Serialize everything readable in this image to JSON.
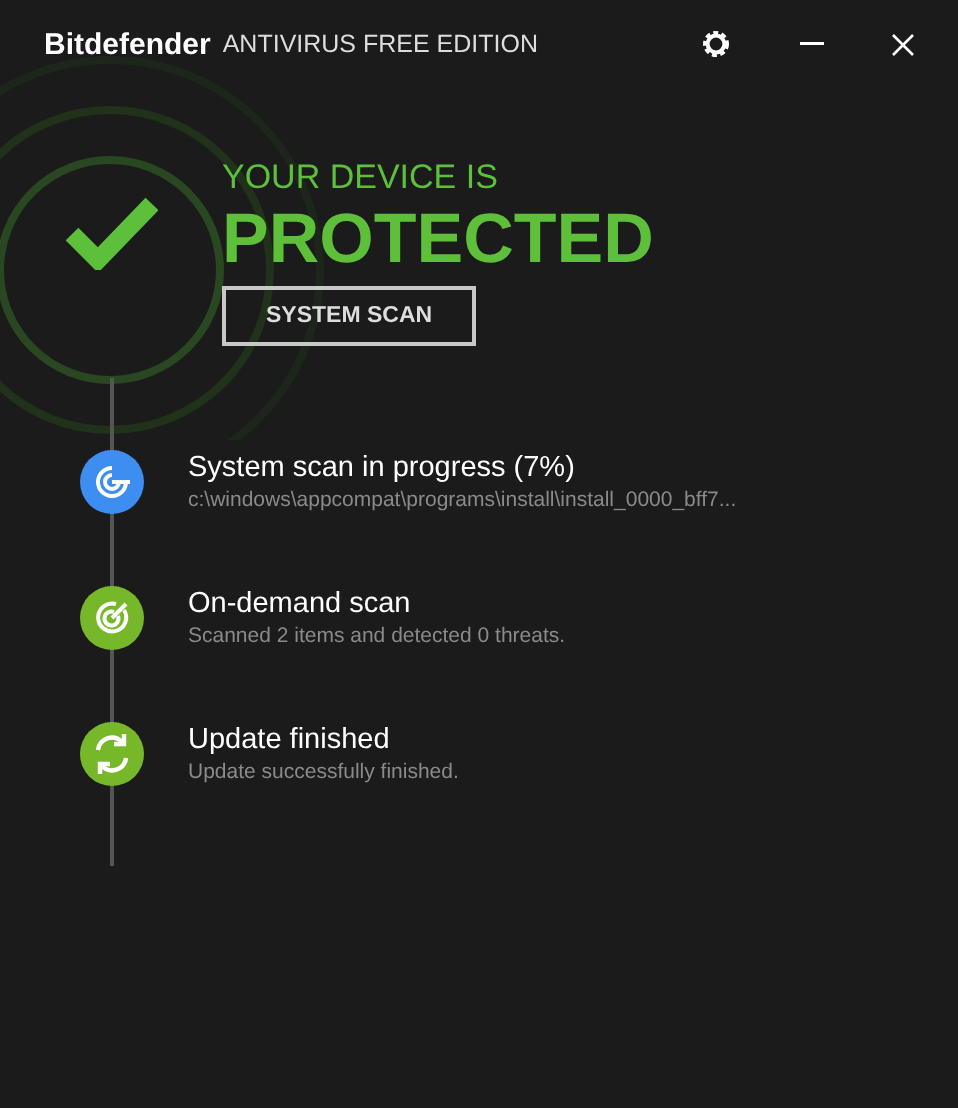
{
  "header": {
    "brand": "Bitdefender",
    "edition": "ANTIVIRUS FREE EDITION"
  },
  "status": {
    "line1": "YOUR DEVICE IS",
    "line2": "PROTECTED",
    "button": "SYSTEM SCAN"
  },
  "events": [
    {
      "kind": "scan-progress",
      "color": "#3d8ef0",
      "title": "System scan in progress (7%)",
      "detail": "c:\\windows\\appcompat\\programs\\install\\install_0000_bff7..."
    },
    {
      "kind": "scan",
      "color": "#77b82a",
      "title": "On-demand scan",
      "detail": "Scanned 2 items and detected 0 threats."
    },
    {
      "kind": "update",
      "color": "#77b82a",
      "title": "Update finished",
      "detail": "Update successfully finished."
    }
  ]
}
